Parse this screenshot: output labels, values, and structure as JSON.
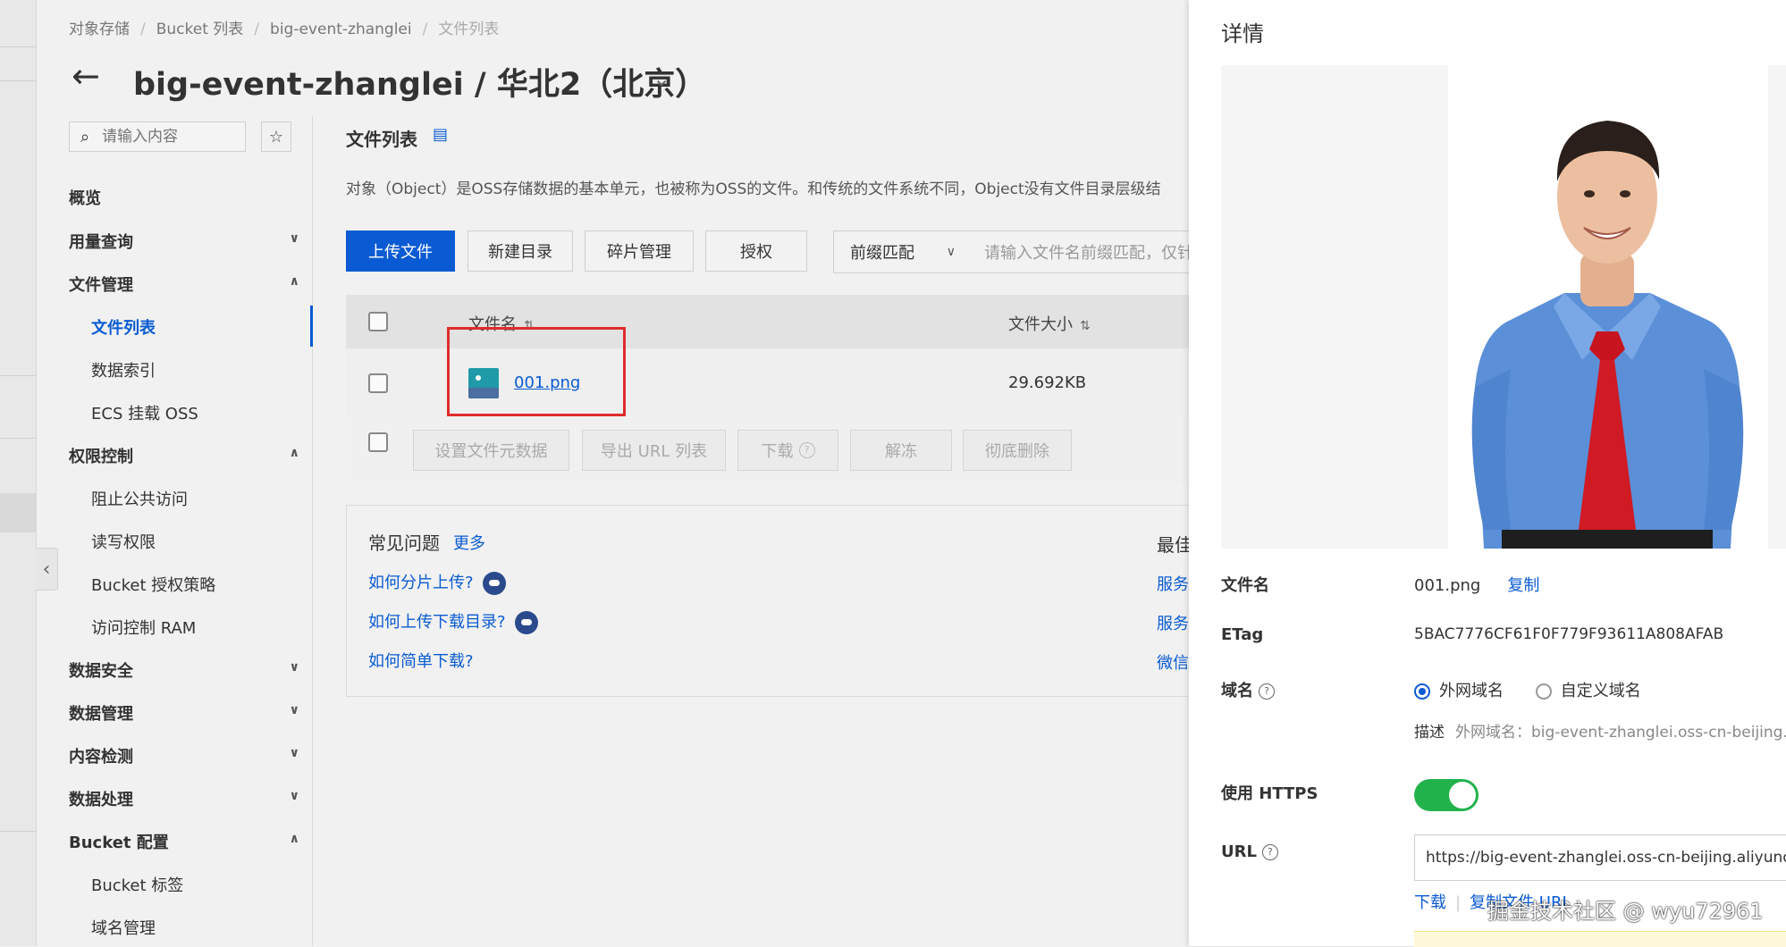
{
  "breadcrumb": [
    "对象存储",
    "Bucket 列表",
    "big-event-zhanglei",
    "文件列表"
  ],
  "title": "big-event-zhanglei / 华北2（北京）",
  "sidebar": {
    "search_placeholder": "请输入内容",
    "items": [
      {
        "label": "概览"
      },
      {
        "label": "用量查询"
      },
      {
        "label": "文件管理"
      },
      {
        "label": "文件列表"
      },
      {
        "label": "数据索引"
      },
      {
        "label": "ECS 挂载 OSS"
      },
      {
        "label": "权限控制"
      },
      {
        "label": "阻止公共访问"
      },
      {
        "label": "读写权限"
      },
      {
        "label": "Bucket 授权策略"
      },
      {
        "label": "访问控制 RAM"
      },
      {
        "label": "数据安全"
      },
      {
        "label": "数据管理"
      },
      {
        "label": "内容检测"
      },
      {
        "label": "数据处理"
      },
      {
        "label": "Bucket 配置"
      },
      {
        "label": "Bucket 标签"
      },
      {
        "label": "域名管理"
      }
    ]
  },
  "main": {
    "section_title": "文件列表",
    "description": "对象（Object）是OSS存储数据的基本单元，也被称为OSS的文件。和传统的文件系统不同，Object没有文件目录层级结",
    "toolbar": {
      "upload": "上传文件",
      "new_dir": "新建目录",
      "fragments": "碎片管理",
      "authorize": "授权",
      "prefix_match": "前缀匹配",
      "search_placeholder": "请输入文件名前缀匹配，仅针"
    },
    "table": {
      "col_name": "文件名",
      "col_size": "文件大小",
      "rows": [
        {
          "name": "001.png",
          "size": "29.692KB"
        }
      ]
    },
    "bulk_actions": {
      "set_meta": "设置文件元数据",
      "export_url": "导出 URL 列表",
      "download": "下载",
      "unfreeze": "解冻",
      "delete": "彻底删除"
    },
    "faq": {
      "title": "常见问题",
      "more": "更多",
      "questions": [
        "如何分片上传?",
        "如何上传下载目录?",
        "如何简单下载?"
      ],
      "right_title": "最佳",
      "right_links": [
        "服务",
        "服务",
        "微信"
      ]
    }
  },
  "drawer": {
    "title": "详情",
    "file_name_label": "文件名",
    "file_name": "001.png",
    "copy": "复制",
    "etag_label": "ETag",
    "etag": "5BAC7776CF61F0F779F93611A808AFAB",
    "domain_label": "域名",
    "domain_options": [
      "外网域名",
      "自定义域名"
    ],
    "desc_label": "描述",
    "desc_value": "外网域名：big-event-zhanglei.oss-cn-beijing.a",
    "https_label": "使用 HTTPS",
    "https_on": true,
    "url_label": "URL",
    "url": "https://big-event-zhanglei.oss-cn-beijing.aliyuncs.c",
    "download": "下载",
    "copy_url": "复制文件 URL"
  },
  "watermark": "掘金技术社区 @ wyu72961",
  "colors": {
    "primary": "#0a5bd3",
    "toggle_on": "#22b24c",
    "highlight_box": "#e02b2b"
  }
}
